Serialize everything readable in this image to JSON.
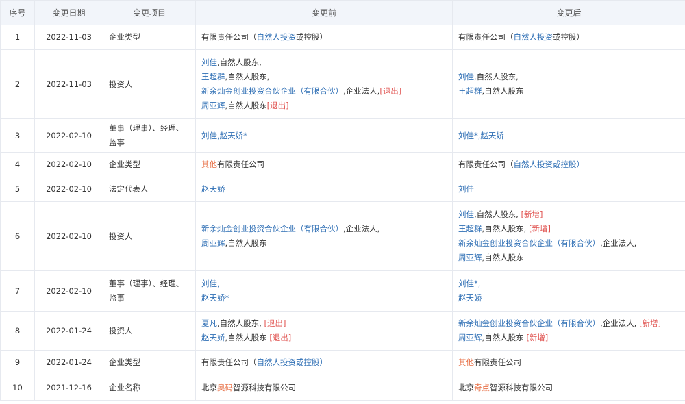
{
  "table": {
    "headers": [
      "序号",
      "变更日期",
      "变更项目",
      "变更前",
      "变更后"
    ],
    "rows": [
      {
        "seq": "1",
        "date": "2022-11-03",
        "item": [
          "企业类型"
        ],
        "before": [
          [
            {
              "t": "有限责任公司（",
              "c": ""
            },
            {
              "t": "自然人投资",
              "c": "blue"
            },
            {
              "t": "或控股）",
              "c": ""
            }
          ]
        ],
        "after": [
          [
            {
              "t": "有限责任公司（",
              "c": ""
            },
            {
              "t": "自然人投资",
              "c": "blue"
            },
            {
              "t": "或控股）",
              "c": ""
            }
          ]
        ],
        "h": 36
      },
      {
        "seq": "2",
        "date": "2022-11-03",
        "item": [
          "投资人"
        ],
        "before": [
          [
            {
              "t": "刘佳",
              "c": "blue"
            },
            {
              "t": ",自然人股东,",
              "c": ""
            }
          ],
          [
            {
              "t": "王超群",
              "c": "blue"
            },
            {
              "t": ",自然人股东,",
              "c": ""
            }
          ],
          [
            {
              "t": "新余灿金创业投资合伙企业（有限合伙）",
              "c": "blue"
            },
            {
              "t": ",企业法人,",
              "c": ""
            },
            {
              "t": "[退出]",
              "c": "red"
            }
          ],
          [
            {
              "t": "周亚辉",
              "c": "blue"
            },
            {
              "t": ",自然人股东",
              "c": ""
            },
            {
              "t": "[退出]",
              "c": "red"
            }
          ]
        ],
        "after": [
          [
            {
              "t": "刘佳",
              "c": "blue"
            },
            {
              "t": ",自然人股东,",
              "c": ""
            }
          ],
          [
            {
              "t": "王超群",
              "c": "blue"
            },
            {
              "t": ",自然人股东",
              "c": ""
            }
          ]
        ],
        "h": 101
      },
      {
        "seq": "3",
        "date": "2022-02-10",
        "item": [
          "董事（理事）、经理、",
          "监事"
        ],
        "before": [
          [
            {
              "t": "刘佳,赵天娇*",
              "c": "blue"
            }
          ]
        ],
        "after": [
          [
            {
              "t": "刘佳*,赵天娇",
              "c": "blue"
            }
          ]
        ],
        "h": 49
      },
      {
        "seq": "4",
        "date": "2022-02-10",
        "item": [
          "企业类型"
        ],
        "before": [
          [
            {
              "t": "其他",
              "c": "orange"
            },
            {
              "t": "有限责任公司",
              "c": ""
            }
          ]
        ],
        "after": [
          [
            {
              "t": "有限责任公司（",
              "c": ""
            },
            {
              "t": "自然人投资或控股）",
              "c": "blue"
            }
          ]
        ],
        "h": 36
      },
      {
        "seq": "5",
        "date": "2022-02-10",
        "item": [
          "法定代表人"
        ],
        "before": [
          [
            {
              "t": "赵天娇",
              "c": "blue"
            }
          ]
        ],
        "after": [
          [
            {
              "t": "刘佳",
              "c": "blue"
            }
          ]
        ],
        "h": 36
      },
      {
        "seq": "6",
        "date": "2022-02-10",
        "item": [
          "投资人"
        ],
        "before": [
          [
            {
              "t": "新余灿金创业投资合伙企业（有限合伙）",
              "c": "blue"
            },
            {
              "t": ",企业法人,",
              "c": ""
            }
          ],
          [
            {
              "t": "周亚辉",
              "c": "blue"
            },
            {
              "t": ",自然人股东",
              "c": ""
            }
          ]
        ],
        "after": [
          [
            {
              "t": "刘佳",
              "c": "blue"
            },
            {
              "t": ",自然人股东, ",
              "c": ""
            },
            {
              "t": "[新增]",
              "c": "red"
            }
          ],
          [
            {
              "t": "王超群",
              "c": "blue"
            },
            {
              "t": ",自然人股东, ",
              "c": ""
            },
            {
              "t": "[新增]",
              "c": "red"
            }
          ],
          [
            {
              "t": "新余灿金创业投资合伙企业（有限合伙）",
              "c": "blue"
            },
            {
              "t": ",企业法人,",
              "c": ""
            }
          ],
          [
            {
              "t": "周亚辉",
              "c": "blue"
            },
            {
              "t": ",自然人股东",
              "c": ""
            }
          ]
        ],
        "h": 101
      },
      {
        "seq": "7",
        "date": "2022-02-10",
        "item": [
          "董事（理事）、经理、",
          "监事"
        ],
        "before": [
          [
            {
              "t": "刘佳,",
              "c": "blue"
            }
          ],
          [
            {
              "t": "赵天娇*",
              "c": "blue"
            }
          ]
        ],
        "after": [
          [
            {
              "t": "刘佳*,",
              "c": "blue"
            }
          ],
          [
            {
              "t": "赵天娇",
              "c": "blue"
            }
          ]
        ],
        "h": 59
      },
      {
        "seq": "8",
        "date": "2022-01-24",
        "item": [
          "投资人"
        ],
        "before": [
          [
            {
              "t": "夏凡",
              "c": "blue"
            },
            {
              "t": ",自然人股东, ",
              "c": ""
            },
            {
              "t": "[退出]",
              "c": "red"
            }
          ],
          [
            {
              "t": "赵天娇",
              "c": "blue"
            },
            {
              "t": ",自然人股东 ",
              "c": ""
            },
            {
              "t": "[退出]",
              "c": "red"
            }
          ]
        ],
        "after": [
          [
            {
              "t": "新余灿金创业投资合伙企业（有限合伙）",
              "c": "blue"
            },
            {
              "t": ",企业法人, ",
              "c": ""
            },
            {
              "t": "[新增]",
              "c": "red"
            }
          ],
          [
            {
              "t": "周亚辉",
              "c": "blue"
            },
            {
              "t": ",自然人股东 ",
              "c": ""
            },
            {
              "t": "[新增]",
              "c": "red"
            }
          ]
        ],
        "h": 57
      },
      {
        "seq": "9",
        "date": "2022-01-24",
        "item": [
          "企业类型"
        ],
        "before": [
          [
            {
              "t": "有限责任公司（",
              "c": ""
            },
            {
              "t": "自然人投资或控股）",
              "c": "blue"
            }
          ]
        ],
        "after": [
          [
            {
              "t": "其他",
              "c": "orange"
            },
            {
              "t": "有限责任公司",
              "c": ""
            }
          ]
        ],
        "h": 36
      },
      {
        "seq": "10",
        "date": "2021-12-16",
        "item": [
          "企业名称"
        ],
        "before": [
          [
            {
              "t": "北京",
              "c": ""
            },
            {
              "t": "奥码",
              "c": "orange"
            },
            {
              "t": "智源科技有限公司",
              "c": ""
            }
          ]
        ],
        "after": [
          [
            {
              "t": "北京",
              "c": ""
            },
            {
              "t": "奇点",
              "c": "orange"
            },
            {
              "t": "智源科技有限公司",
              "c": ""
            }
          ]
        ],
        "h": 37
      }
    ]
  }
}
